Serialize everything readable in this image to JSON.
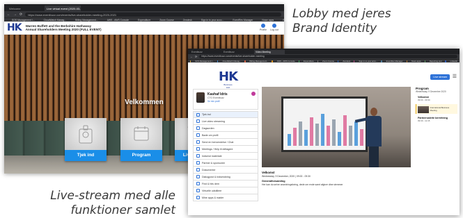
{
  "captions": {
    "top_right": [
      "Lobby med jeres",
      "Brand Identity"
    ],
    "bottom_left": [
      "Live-stream med alle",
      "funktioner samlet"
    ]
  },
  "lobby": {
    "tabs": [
      "Welcome",
      "Live virtual event (2020-03-...)"
    ],
    "url": "https://www.eventbuzz.com/events/live-shareholder-meeting-2020-2021",
    "bookmarks": [
      "SOS Management I...",
      "CloudWatch Manag...",
      "Billing Management...",
      "AWS - AWS Console",
      "Expenditure",
      "Zoom Course",
      "Zendesk",
      "Sign in to your acco...",
      "EventRev Manager",
      "Nowx apps",
      "Reporting tool",
      "https://eventbuzz.c..."
    ],
    "header": {
      "logo": "HK",
      "event_title": "Warren Buffett and the Berkshire Hathaway",
      "event_subtitle": "Annual Shareholders Meeting 2020 (FULL EVENT)",
      "profile_label": "Profile",
      "logout_label": "Log out"
    },
    "welcome": "Velkommen",
    "tiles": [
      {
        "label": "Tjek ind",
        "icon": "id-badge-icon"
      },
      {
        "label": "Program",
        "icon": "calendar-icon"
      },
      {
        "label": "Live stream",
        "icon": "clapperboard-icon"
      }
    ]
  },
  "stream": {
    "tabs": [
      "Eventbuzz",
      "Eventbuzz",
      "Video Meeting"
    ],
    "url": "https://www.eventbuzz.com/events/live-shareholder-meeting",
    "bookmarks": [
      "SOS Management I...",
      "CloudWatch Manag...",
      "Billing Management...",
      "AWS - AWS Console",
      "Expenditure",
      "Zoom Course",
      "Zendesk",
      "Sign in to your acco...",
      "EventRev Manager",
      "Nowx apps",
      "Reporting tool",
      "Linkedin"
    ],
    "logo": "HK",
    "logo_sub": [
      "Business",
      "Hub"
    ],
    "live_button": "Live stream",
    "profile": {
      "name": "Kashaf Idris",
      "title": "CTO Eventbuzz",
      "link": "Se min profil"
    },
    "menu": [
      "Tjek ind",
      "Live video streaming",
      "Dagsorden",
      "Bøde om profil",
      "Send en henvendelse / Chat",
      "Meetings / Help til deltagere",
      "Indsend materiale",
      "Partner & sponsoree",
      "Dokumenter",
      "Dialogpost & indsendning",
      "Find & hits dem",
      "Virtuelle udstillere",
      "Mine apps & møder"
    ],
    "session": {
      "head": "Velkomst",
      "time": "Wednesday, 9 December, 2020 | 09:00 - 09:30",
      "sub": "Generalforsamling",
      "desc": "Her kan du se/ne anordningsforing, dede om ende samt afgiver dine stemmer"
    },
    "program": {
      "title": "Program",
      "date": "Wednesday, 9 December 2020",
      "items": [
        {
          "title": "Velkomst",
          "time": "09:00 - 09:30"
        },
        {
          "title": "International Business Meeting",
          "time": ""
        },
        {
          "title": "Partnersalerte berretning",
          "time": "09:30 - 11:15"
        }
      ]
    }
  },
  "chart_colors": {
    "blue": "#5aa0dc",
    "pink": "#e07aa3",
    "grey": "#9aa5b1"
  }
}
